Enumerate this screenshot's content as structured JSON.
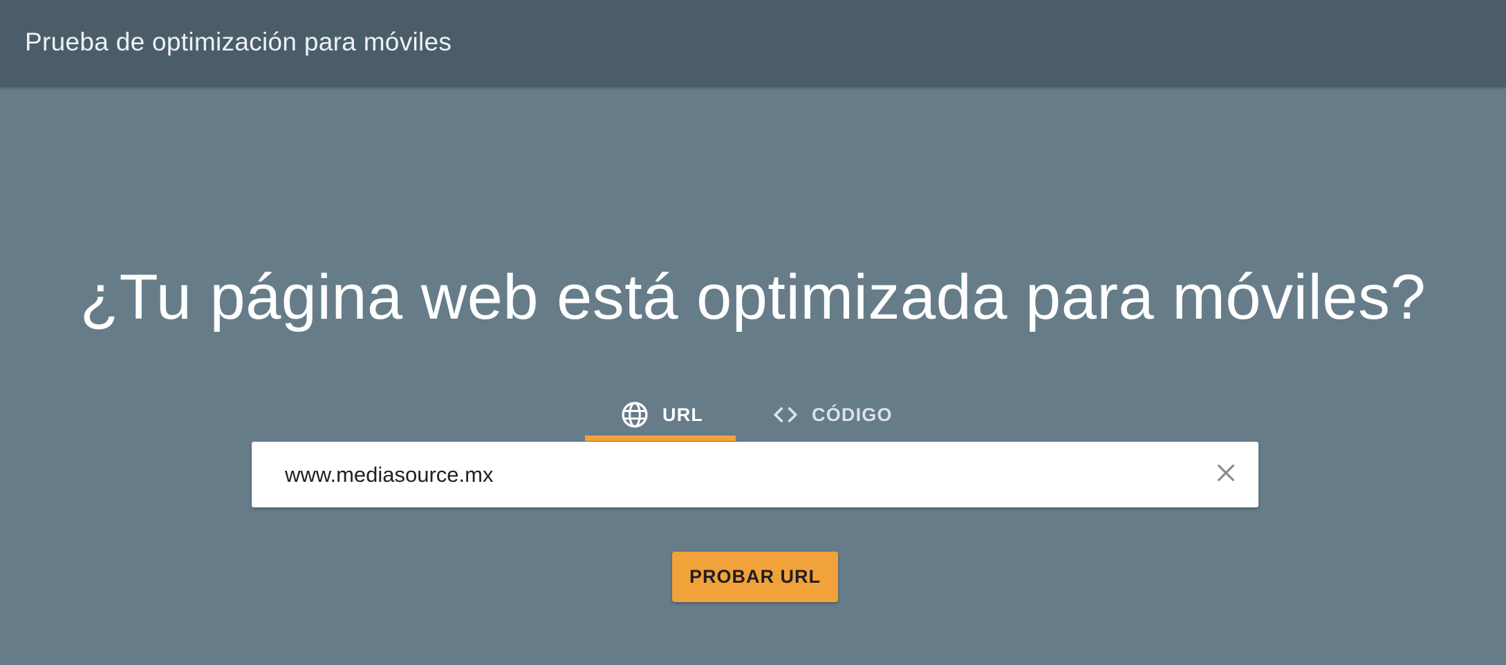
{
  "header": {
    "title": "Prueba de optimización para móviles"
  },
  "main": {
    "headline": "¿Tu página web está optimizada para móviles?",
    "tabs": [
      {
        "label": "URL",
        "icon": "globe-icon",
        "selected": true
      },
      {
        "label": "CÓDIGO",
        "icon": "code-icon",
        "selected": false
      }
    ],
    "url_input": {
      "value": "www.mediasource.mx",
      "clear_icon": "close-icon"
    },
    "submit_label": "PROBAR URL"
  },
  "colors": {
    "topbar": "#4b5d69",
    "background": "#667c89",
    "accent": "#f2a23a"
  }
}
